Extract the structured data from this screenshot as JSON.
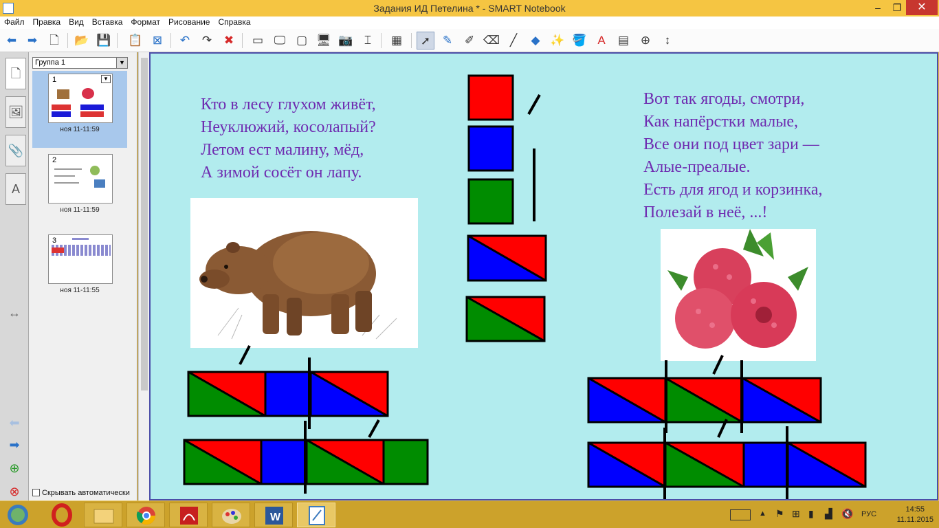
{
  "window": {
    "title": "Задания ИД Петелина * - SMART Notebook",
    "minimize": "–",
    "maximize": "❐",
    "close": "✕"
  },
  "menu": [
    "Файл",
    "Правка",
    "Вид",
    "Вставка",
    "Формат",
    "Рисование",
    "Справка"
  ],
  "sorter": {
    "group": "Группа 1",
    "pages": [
      {
        "number": "1",
        "time": "ноя 11-11:59"
      },
      {
        "number": "2",
        "time": "ноя 11-11:59"
      },
      {
        "number": "3",
        "time": "ноя 11-11:55"
      }
    ],
    "auto_hide": "Скрывать автоматически"
  },
  "slide": {
    "poem_left": [
      "Кто в лесу глухом живёт,",
      "Неуклюжий, косолапый?",
      "Летом ест малину, мёд,",
      "А зимой сосёт он лапу."
    ],
    "poem_right": [
      "Вот так ягоды, смотри,",
      "Как напёрстки малые,",
      "Все они под цвет зари —",
      "Алые-преалые.",
      "Есть для ягод и корзинка,",
      "Полезай в неё, ...!"
    ]
  },
  "colors": {
    "red": "#ff0000",
    "blue": "#0000ff",
    "green": "#008c00",
    "text": "#6e2bb0",
    "canvas": "#b2ecee"
  },
  "taskbar": {
    "language": "РУС",
    "time": "14:55",
    "date": "11.11.2015"
  }
}
